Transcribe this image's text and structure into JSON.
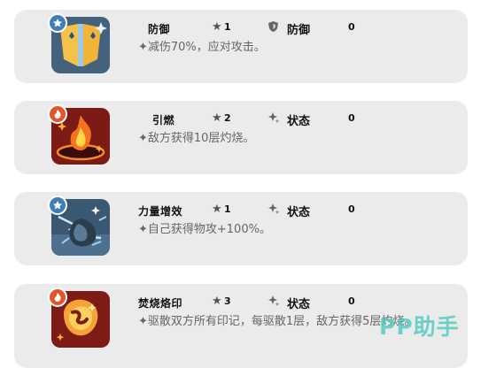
{
  "skills": [
    {
      "name": "防御",
      "stars": "1",
      "category_icon": "shield-icon",
      "category": "防御",
      "cost": "0",
      "badge_icon": "water-badge-icon",
      "badge_color": "#3f7fb6",
      "description": "✦减伤70%，应对攻击。"
    },
    {
      "name": "引燃",
      "stars": "2",
      "category_icon": "sparkle-icon",
      "category": "状态",
      "cost": "0",
      "badge_icon": "fire-badge-icon",
      "badge_color": "#e2542a",
      "description": "✦敌方获得10层灼烧。"
    },
    {
      "name": "力量增效",
      "stars": "1",
      "category_icon": "sparkle-icon",
      "category": "状态",
      "cost": "0",
      "badge_icon": "water-badge-icon",
      "badge_color": "#3f7fb6",
      "description": "✦自己获得物攻+100%。"
    },
    {
      "name": "焚烧烙印",
      "stars": "3",
      "category_icon": "sparkle-icon",
      "category": "状态",
      "cost": "0",
      "badge_icon": "fire-badge-icon",
      "badge_color": "#e2542a",
      "description": "✦驱散双方所有印记，每驱散1层，敌方获得5层灼烧。"
    }
  ],
  "watermark": "PP助手"
}
